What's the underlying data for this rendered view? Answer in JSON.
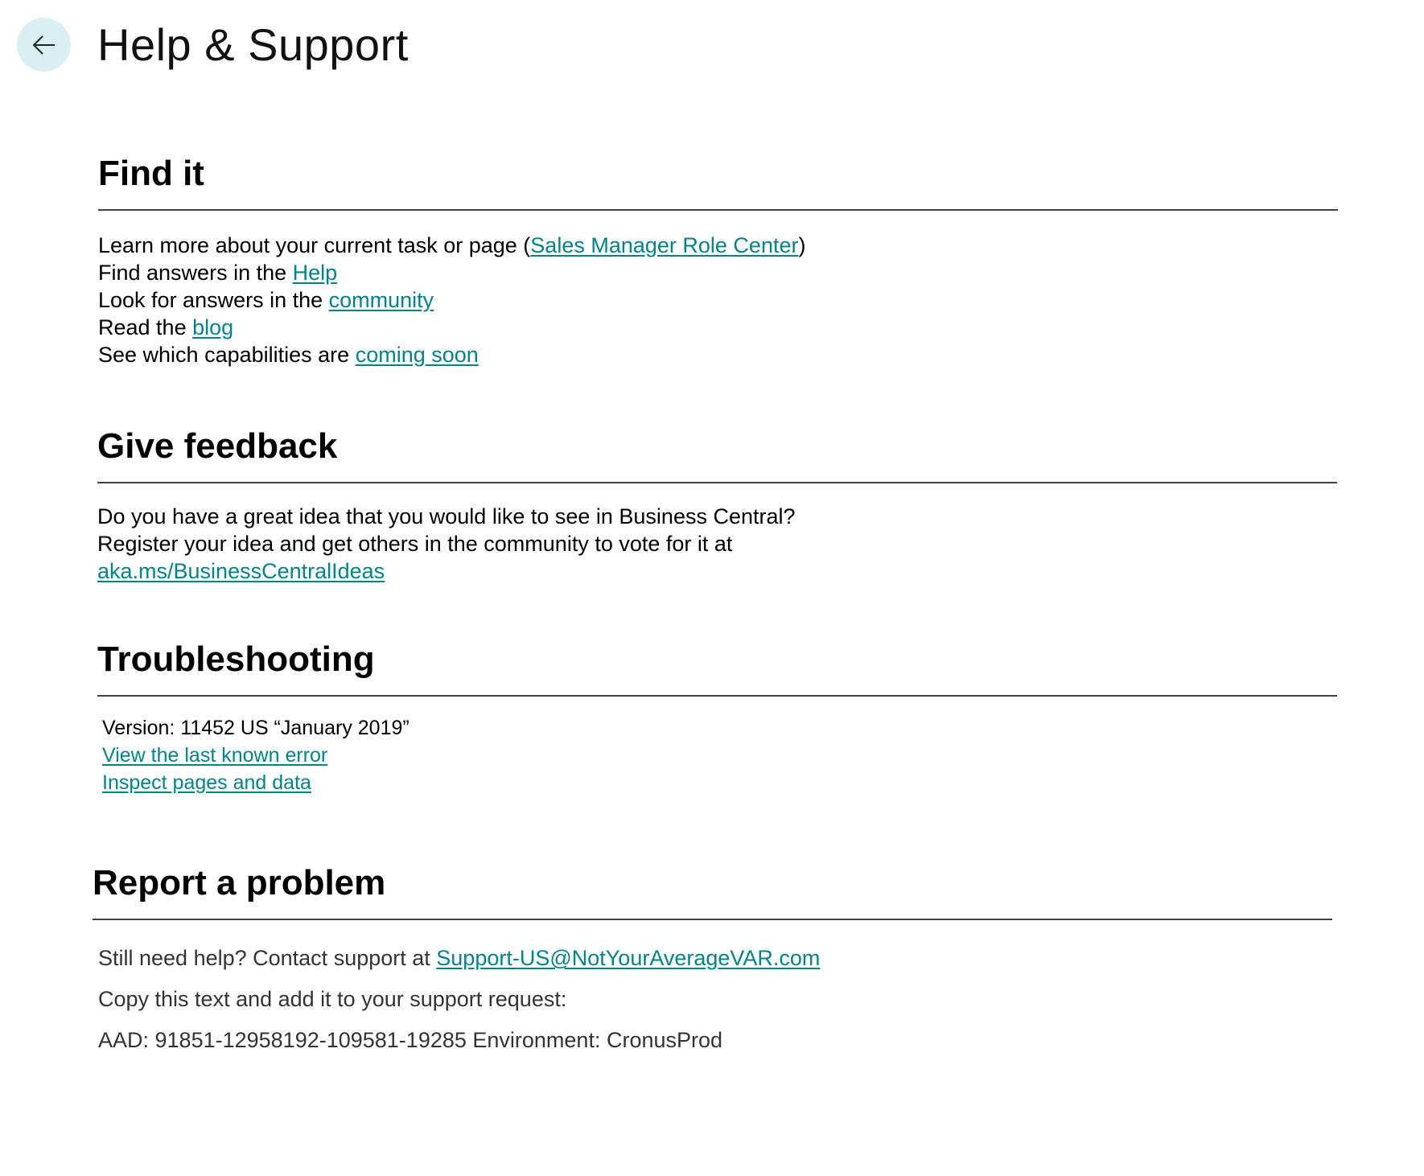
{
  "header": {
    "back_icon": "arrow-left-icon",
    "title": "Help & Support"
  },
  "colors": {
    "link": "#00838a",
    "back_button_bg": "#d9eff2",
    "rule": "#404040"
  },
  "find_it": {
    "heading": "Find it",
    "lines": [
      {
        "prefix": "Learn more about your current task or page (",
        "link": "Sales Manager Role Center",
        "suffix": ")"
      },
      {
        "prefix": "Find answers in the ",
        "link": "Help",
        "suffix": ""
      },
      {
        "prefix": "Look for answers in the ",
        "link": "community",
        "suffix": ""
      },
      {
        "prefix": "Read the ",
        "link": "blog",
        "suffix": ""
      },
      {
        "prefix": "See which capabilities are ",
        "link": "coming soon",
        "suffix": ""
      }
    ]
  },
  "give_feedback": {
    "heading": "Give feedback",
    "line1": "Do you have a great idea that you would like to see in Business Central?",
    "line2": "Register your idea and get others in the community to vote for it at",
    "link": "aka.ms/BusinessCentralIdeas"
  },
  "troubleshooting": {
    "heading": "Troubleshooting",
    "version": "Version:  11452 US “January 2019”",
    "links": [
      "View the last known error",
      "Inspect pages and data"
    ]
  },
  "report_problem": {
    "heading": "Report a problem",
    "contact_prefix": "Still need help? Contact support at ",
    "contact_email": "Support-US@NotYourAverageVAR.com",
    "copy_text": "Copy this text and add it to your support request:",
    "aad_text": "AAD: 91851-12958192-109581-19285 Environment: CronusProd"
  }
}
